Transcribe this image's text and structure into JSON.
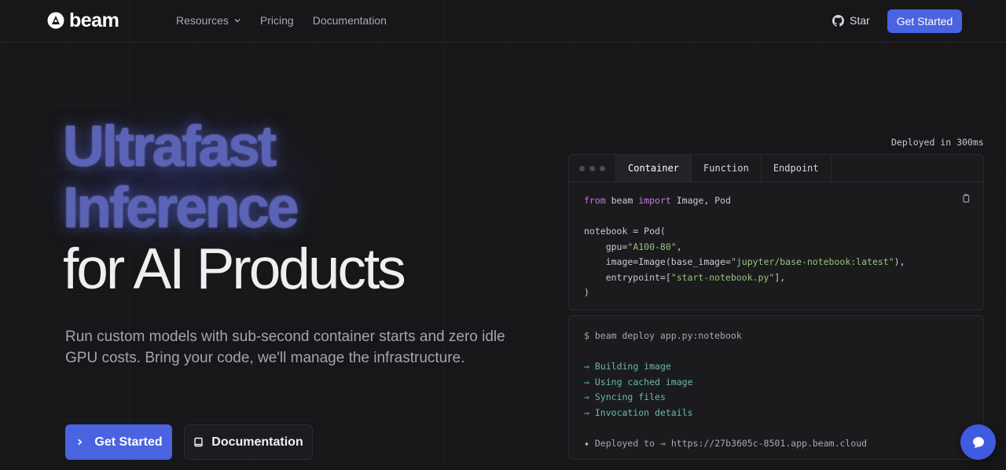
{
  "nav": {
    "brand": "beam",
    "links": [
      {
        "label": "Resources",
        "has_dropdown": true
      },
      {
        "label": "Pricing"
      },
      {
        "label": "Documentation"
      }
    ],
    "star_label": "Star",
    "cta_label": "Get Started"
  },
  "hero": {
    "title_line1": "Ultrafast",
    "title_line2": "Inference",
    "title_line3": "for AI Products",
    "subtitle": "Run custom models with sub-second container starts and zero idle GPU costs. Bring your code, we'll manage the infrastructure.",
    "primary_button": "Get Started",
    "secondary_button": "Documentation"
  },
  "code_panel": {
    "deployed_label": "Deployed in 300ms",
    "tabs": [
      "Container",
      "Function",
      "Endpoint"
    ],
    "active_tab": "Container",
    "code": {
      "l1_from": "from",
      "l1_module": " beam ",
      "l1_import": "import",
      "l1_names": " Image, Pod",
      "l3": "notebook = Pod(",
      "l4_key": "    gpu=",
      "l4_val": "\"A100-80\"",
      "l4_end": ",",
      "l5_key": "    image=Image(base_image=",
      "l5_val": "\"jupyter/base-notebook:latest\"",
      "l5_end": "),",
      "l6_key": "    entrypoint=[",
      "l6_val": "\"start-notebook.py\"",
      "l6_end": "],",
      "l7": ")"
    }
  },
  "terminal": {
    "command": "$ beam deploy app.py:notebook",
    "arrow": "⇒",
    "steps": [
      "Building image",
      "Using cached image",
      "Syncing files",
      "Invocation details"
    ],
    "deployed_prefix": "Deployed to",
    "deployed_url": "https://27b3605c-8501.app.beam.cloud"
  },
  "colors": {
    "accent": "#4a63e0",
    "background": "#17171a",
    "title_accent": "#5b63b7"
  }
}
